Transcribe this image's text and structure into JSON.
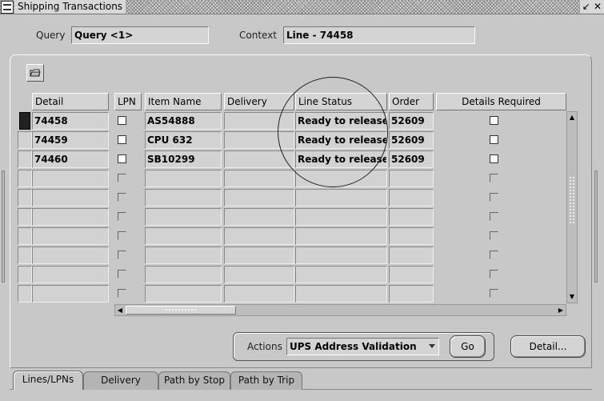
{
  "window": {
    "title": "Shipping Transactions",
    "controls": [
      "↙",
      "✕"
    ]
  },
  "header": {
    "query_label": "Query",
    "query_value": "Query <1>",
    "context_label": "Context",
    "context_value": "Line - 74458"
  },
  "table": {
    "columns": {
      "detail": "Detail",
      "lpn": "LPN",
      "item_name": "Item Name",
      "delivery": "Delivery",
      "line_status": "Line Status",
      "order": "Order",
      "details_required": "Details Required"
    },
    "rows": [
      {
        "detail": "74458",
        "item_name": "AS54888",
        "delivery": "",
        "line_status": "Ready to release",
        "order": "52609",
        "details_required": false
      },
      {
        "detail": "74459",
        "item_name": "CPU 632",
        "delivery": "",
        "line_status": "Ready to release",
        "order": "52609",
        "details_required": false
      },
      {
        "detail": "74460",
        "item_name": "SB10299",
        "delivery": "",
        "line_status": "Ready to release",
        "order": "52609",
        "details_required": false
      }
    ],
    "empty_row_count": 7
  },
  "actions": {
    "label": "Actions",
    "selected": "UPS Address Validation",
    "go_label": "Go",
    "detail_label": "Detail..."
  },
  "tabs": [
    "Lines/LPNs",
    "Delivery",
    "Path by Stop",
    "Path by Trip"
  ],
  "active_tab": "Lines/LPNs"
}
